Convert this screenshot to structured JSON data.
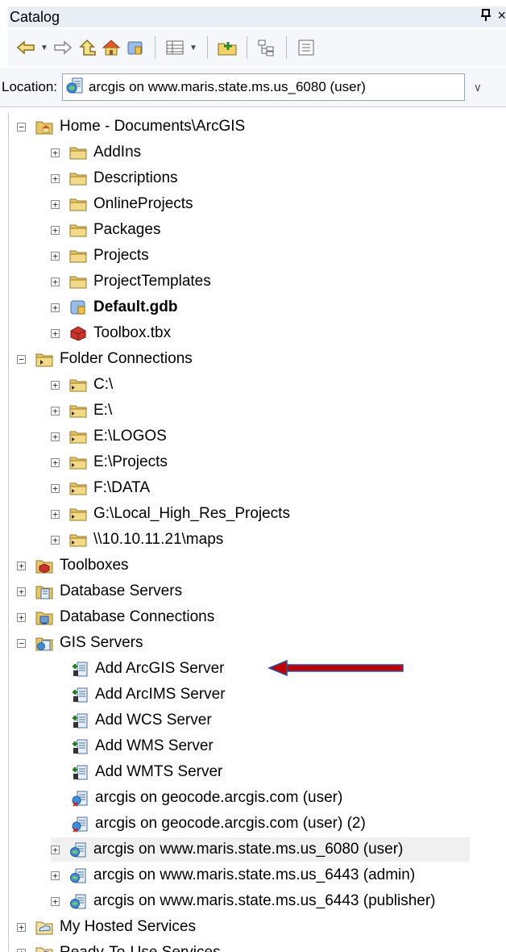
{
  "window": {
    "title": "Catalog",
    "pin_glyph": "ᴪ",
    "close_glyph": "×"
  },
  "toolbar": {
    "buttons": [
      "back-icon",
      "forward-icon",
      "up-one-level-icon",
      "home-icon",
      "default-gdb-icon",
      "view-icon",
      "connect-folder-icon",
      "toggle-tree-icon",
      "options-icon"
    ]
  },
  "location": {
    "label": "Location:",
    "value": "arcgis on www.maris.state.ms.us_6080 (user)"
  },
  "tree": {
    "home": "Home - Documents\\ArcGIS",
    "home_items": [
      "AddIns",
      "Descriptions",
      "OnlineProjects",
      "Packages",
      "Projects",
      "ProjectTemplates",
      "Default.gdb",
      "Toolbox.tbx"
    ],
    "folder_connections": "Folder Connections",
    "folders": [
      "C:\\",
      "E:\\",
      "E:\\LOGOS",
      "E:\\Projects",
      "F:\\DATA",
      "G:\\Local_High_Res_Projects",
      "\\\\10.10.11.21\\maps"
    ],
    "toolboxes": "Toolboxes",
    "database_servers": "Database Servers",
    "database_connections": "Database Connections",
    "gis_servers": "GIS Servers",
    "gis_items": [
      "Add ArcGIS Server",
      "Add ArcIMS Server",
      "Add WCS Server",
      "Add WMS Server",
      "Add WMTS Server",
      "arcgis on geocode.arcgis.com (user)",
      "arcgis on geocode.arcgis.com (user) (2)",
      "arcgis on www.maris.state.ms.us_6080 (user)",
      "arcgis on www.maris.state.ms.us_6443 (admin)",
      "arcgis on www.maris.state.ms.us_6443 (publisher)"
    ],
    "my_hosted_services": "My Hosted Services",
    "ready_to_use_services": "Ready-To-Use Services"
  },
  "colors": {
    "arrow": "#c00000",
    "folder": "#e8c56a",
    "selection": "#f0f0f0"
  }
}
